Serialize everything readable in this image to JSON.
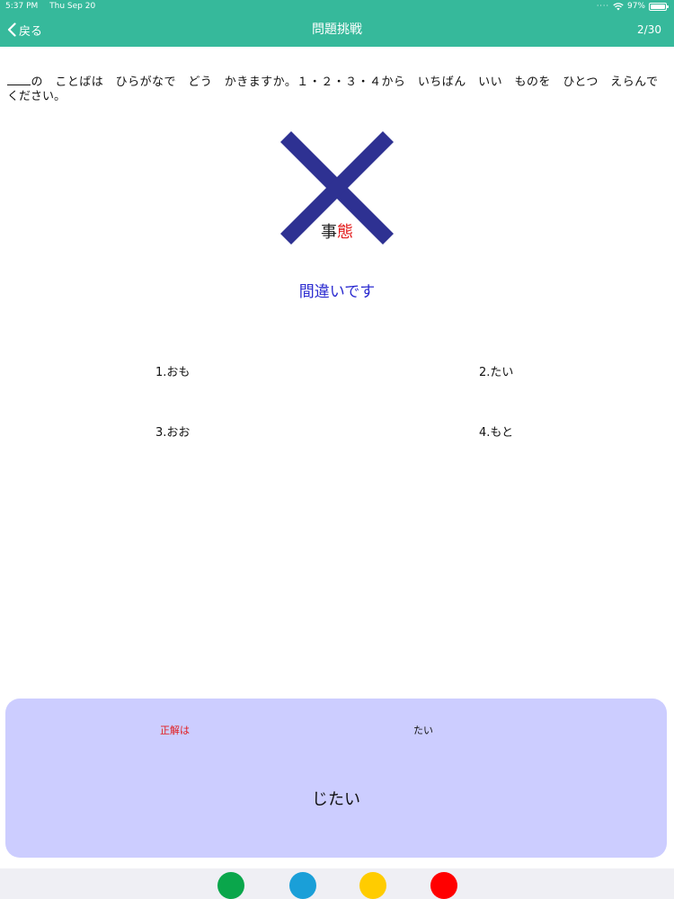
{
  "status_bar": {
    "time": "5:37 PM",
    "date": "Thu Sep 20",
    "battery": "97%",
    "battery_level": 0.97
  },
  "nav": {
    "back_label": "戻る",
    "title": "問題挑戦",
    "progress": "2/30"
  },
  "question": {
    "text": "の　ことばは　ひらがなで　どう　かきますか。１・２・３・４から　いちばん　いい　ものを　ひとつ　えらんで　ください。"
  },
  "result": {
    "word_prefix": "事",
    "word_highlight": "態",
    "message": "間違いです",
    "mark_color": "#2e3192"
  },
  "choices": [
    {
      "label": "1.おも"
    },
    {
      "label": "2.たい"
    },
    {
      "label": "3.おお"
    },
    {
      "label": "4.もと"
    }
  ],
  "answer": {
    "label": "正解は",
    "part": "たい",
    "reading": "じたい"
  },
  "colors": {
    "accent": "#36b99b",
    "panel": "#cccdff",
    "wrong_message": "#2b2bd0",
    "highlight": "#e21a1a"
  },
  "color_dots": [
    {
      "color": "#0aa64b"
    },
    {
      "color": "#1a9fd8"
    },
    {
      "color": "#ffcc00"
    },
    {
      "color": "#ff0000"
    }
  ]
}
